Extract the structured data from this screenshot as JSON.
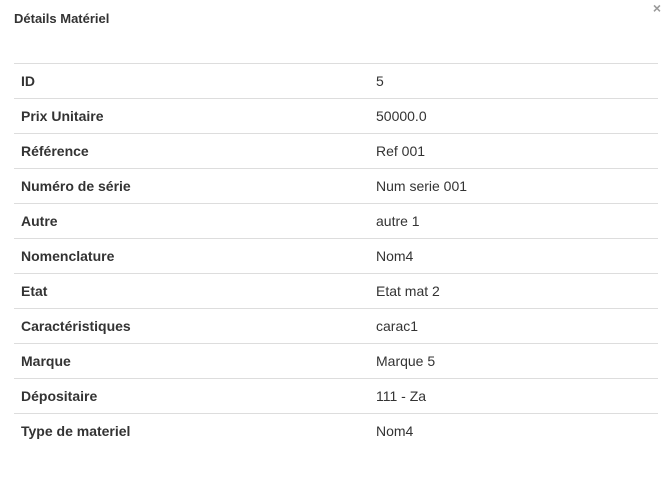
{
  "modal": {
    "title": "Détails Matériel",
    "close_label": "×"
  },
  "rows": [
    {
      "label": "ID",
      "value": "5"
    },
    {
      "label": "Prix Unitaire",
      "value": "50000.0"
    },
    {
      "label": "Référence",
      "value": "Ref 001"
    },
    {
      "label": "Numéro de série",
      "value": "Num serie 001"
    },
    {
      "label": "Autre",
      "value": "autre 1"
    },
    {
      "label": "Nomenclature",
      "value": "Nom4"
    },
    {
      "label": "Etat",
      "value": "Etat mat 2"
    },
    {
      "label": "Caractéristiques",
      "value": "carac1"
    },
    {
      "label": "Marque",
      "value": "Marque 5"
    },
    {
      "label": "Dépositaire",
      "value": "111 - Za"
    },
    {
      "label": "Type de materiel",
      "value": "Nom4"
    }
  ]
}
